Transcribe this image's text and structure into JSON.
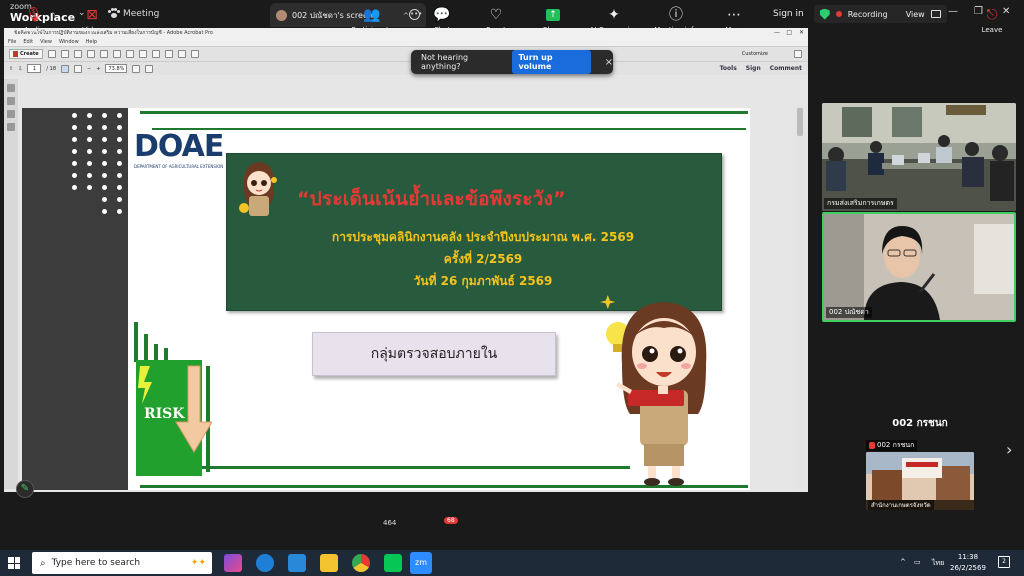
{
  "zoom": {
    "brand_top": "zoom",
    "brand_bottom": "Workplace",
    "meeting_label": "Meeting",
    "share_tab_label": "002 ปณัชดา's screen",
    "sign_in": "Sign in",
    "recording": "Recording",
    "view": "View"
  },
  "toast": {
    "message": "Not hearing anything?",
    "button": "Turn up volume",
    "close": "×"
  },
  "acrobat": {
    "window_title": "ข้อคิดชวนใช้ในการปฏิบัติงานของกรมส่งเสริม ความเสี่ยงในการบัญชี - Adobe Acrobat Pro",
    "menu": [
      "File",
      "Edit",
      "View",
      "Window",
      "Help"
    ],
    "create_label": "Create",
    "customize_label": "Customize",
    "page_current": "1",
    "page_total": "/ 18",
    "zoom_value": "73.8%",
    "tools": "Tools",
    "sign": "Sign",
    "comment": "Comment"
  },
  "slide": {
    "logo_text": "DOAE",
    "logo_sub": "DEPARTMENT OF AGRICULTURAL EXTENSION",
    "title": "“ประเด็นเน้นย้ำและข้อพึงระวัง”",
    "line1": "การประชุมคลินิกงานคลัง ประจำปีงบประมาณ พ.ศ. 2569",
    "line2": "ครั้งที่ 2/2569",
    "line3": "วันที่ 26 กุมภาพันธ์ 2569",
    "group_label": "กลุ่มตรวจสอบภายใน",
    "risk_label": "RISK"
  },
  "participants": {
    "video1_label": "กรมส่งเสริมการเกษตร",
    "video2_label": "002 ปณัชดา",
    "featured_name": "002 กรชนก",
    "thumb_label": "002 กรชนก",
    "thumb_caption": "สำนักงานเกษตรจังหวัด"
  },
  "toolbar": {
    "audio": "Audio",
    "video": "Video",
    "participants": "Participants",
    "participant_count": "464",
    "chat": "Chat",
    "chat_badge": "68",
    "react": "React",
    "share": "Share",
    "ai_companion": "AI Companion",
    "meeting_info": "Meeting info",
    "more": "More",
    "leave": "Leave"
  },
  "taskbar": {
    "search_placeholder": "Type here to search",
    "zm_label": "zm",
    "lang": "ไทย",
    "time": "11:38",
    "date": "26/2/2569",
    "notifications": "2"
  },
  "colors": {
    "zoom_bg": "#1a1a1a",
    "toast_button": "#1a6bdc",
    "slide_green": "#285a3e",
    "slide_title_red": "#e53935",
    "slide_gold": "#f5c31a",
    "active_speaker": "#3fcf5f",
    "recording_dot": "#e53935"
  }
}
